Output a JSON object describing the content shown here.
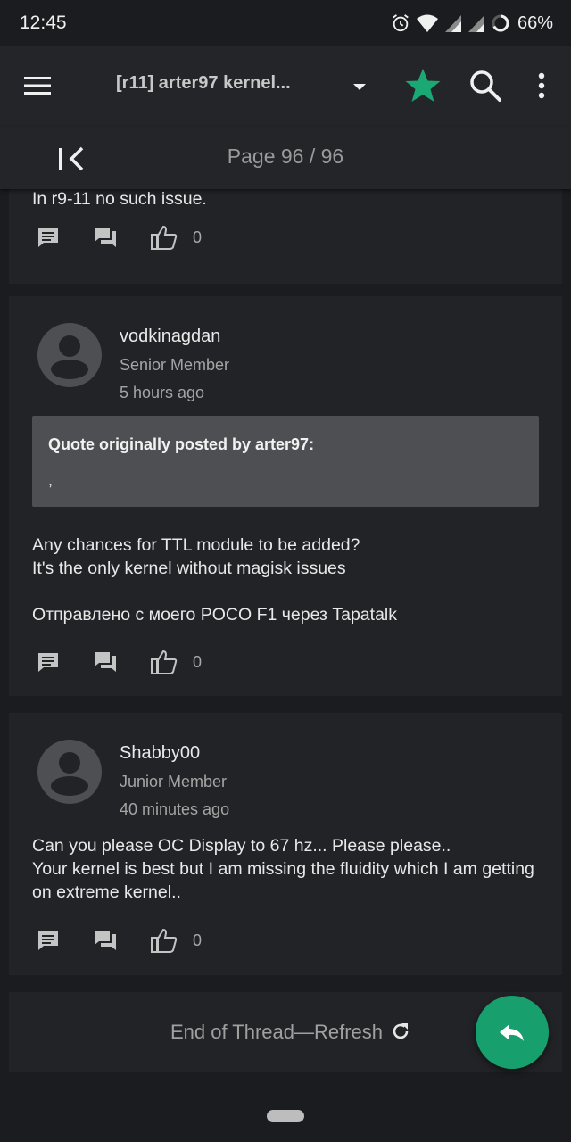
{
  "status_bar": {
    "time": "12:45",
    "battery": "66%",
    "icons": [
      "alarm-icon",
      "wifi-icon",
      "signal-icon",
      "signal-icon",
      "battery-ring-icon"
    ]
  },
  "app_bar": {
    "title": "[r11] arter97 kernel...",
    "star_color": "#1aa874"
  },
  "page_bar": {
    "indicator": "Page 96 / 96"
  },
  "posts": [
    {
      "text": "In r9-11 no such issue.",
      "likes": "0"
    },
    {
      "username": "vodkinagdan",
      "rank": "Senior Member",
      "time": "5 hours ago",
      "quote": {
        "title": "Quote originally posted by arter97:",
        "body": ","
      },
      "text": "Any chances for TTL module to be added?\nIt's the only kernel without magisk issues\n\nОтправлено с моего POCO F1 через Tapatalk",
      "likes": "0"
    },
    {
      "username": "Shabby00",
      "rank": "Junior Member",
      "time": "40 minutes ago",
      "text": "Can you please OC Display to 67 hz... Please please..\nYour kernel is best but I am missing the fluidity which I am getting on extreme kernel..",
      "likes": "0"
    }
  ],
  "footer": {
    "end_label": "End of Thread—Refresh"
  },
  "colors": {
    "accent": "#17a06e",
    "background": "#1b1c1f",
    "card": "#222327"
  }
}
